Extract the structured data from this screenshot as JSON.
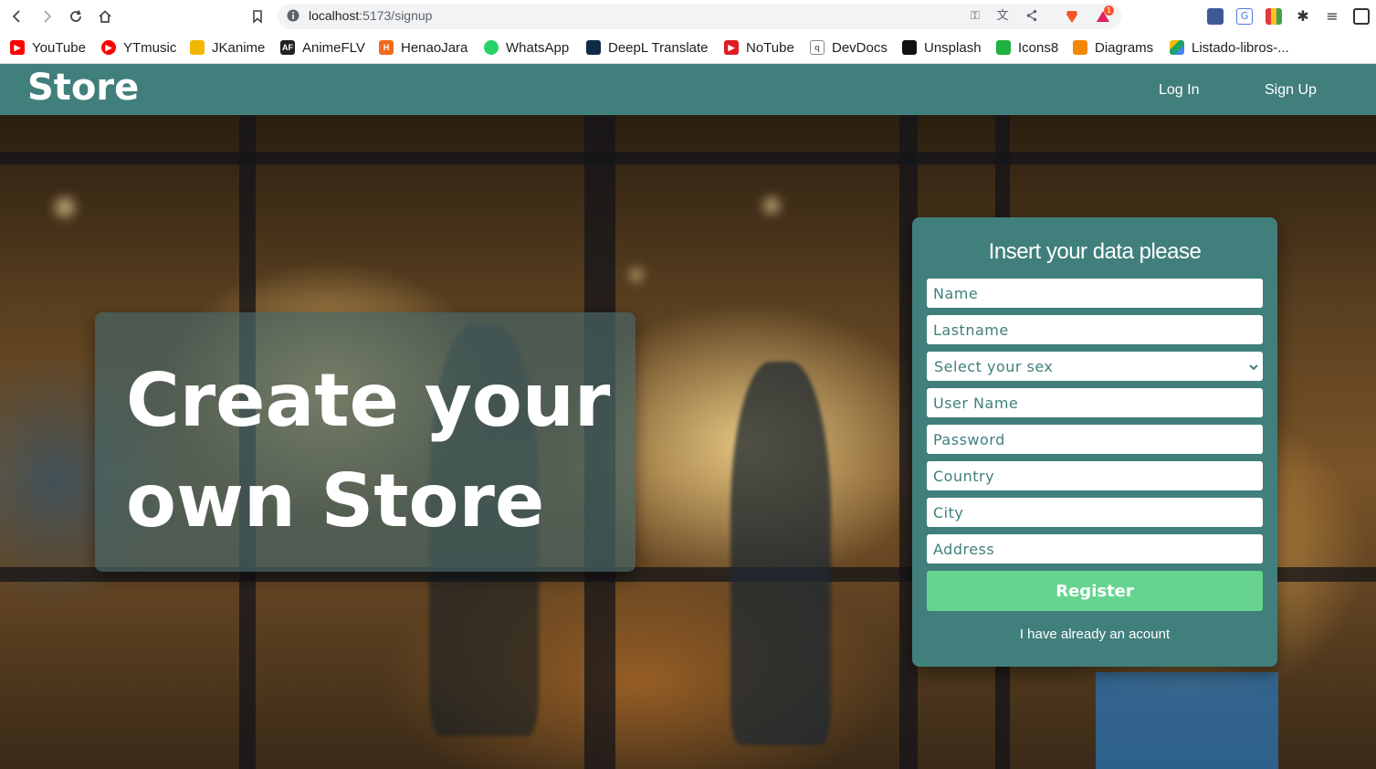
{
  "browser": {
    "url_host": "localhost",
    "url_rest": ":5173/signup",
    "bookmarks": [
      {
        "label": "YouTube",
        "icon": "youtube-icon",
        "color": "#ff0000"
      },
      {
        "label": "YTmusic",
        "icon": "ytmusic-icon",
        "color": "#ff0000"
      },
      {
        "label": "JKanime",
        "icon": "jkanime-icon",
        "color": "#f2b600"
      },
      {
        "label": "AnimeFLV",
        "icon": "animeflv-icon",
        "color": "#222222"
      },
      {
        "label": "HenaoJara",
        "icon": "henaojara-icon",
        "color": "#f26b1d"
      },
      {
        "label": "WhatsApp",
        "icon": "whatsapp-icon",
        "color": "#25d366"
      },
      {
        "label": "DeepL Translate",
        "icon": "deepl-icon",
        "color": "#0f2b46"
      },
      {
        "label": "NoTube",
        "icon": "notube-icon",
        "color": "#e01b24"
      },
      {
        "label": "DevDocs",
        "icon": "devdocs-icon",
        "color": "#888888"
      },
      {
        "label": "Unsplash",
        "icon": "unsplash-icon",
        "color": "#111111"
      },
      {
        "label": "Icons8",
        "icon": "icons8-icon",
        "color": "#1fb141"
      },
      {
        "label": "Diagrams",
        "icon": "diagrams-icon",
        "color": "#f08705"
      },
      {
        "label": "Listado-libros-...",
        "icon": "google-drive-icon",
        "color": "#1fa463"
      }
    ],
    "brave_badge": "1"
  },
  "header": {
    "brand": "Store",
    "login_label": "Log  In",
    "signup_label": "Sign Up",
    "bg_color": "#417f7c"
  },
  "hero": {
    "title_line1": "Create your",
    "title_line2": "own Store"
  },
  "form": {
    "title": "Insert your data please",
    "name_placeholder": "Name",
    "lastname_placeholder": "Lastname",
    "sex_placeholder": "Select your sex",
    "username_placeholder": "User Name",
    "password_placeholder": "Password",
    "country_placeholder": "Country",
    "city_placeholder": "City",
    "address_placeholder": "Address",
    "register_label": "Register",
    "login_link": "I have already an acount",
    "button_color": "#66d48f"
  }
}
